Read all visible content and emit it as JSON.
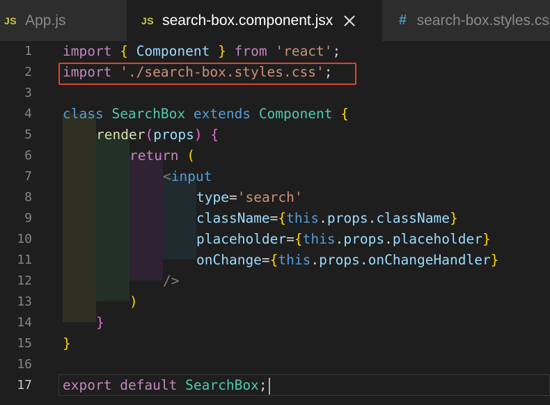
{
  "tabs": [
    {
      "icon": "JS",
      "label": "App.js",
      "active": false
    },
    {
      "icon": "JS",
      "label": "search-box.component.jsx",
      "active": true
    },
    {
      "icon": "#",
      "label": "search-box.styles.css",
      "active": false
    }
  ],
  "line_numbers": [
    "1",
    "2",
    "3",
    "4",
    "5",
    "6",
    "7",
    "8",
    "9",
    "10",
    "11",
    "12",
    "13",
    "14",
    "15",
    "16",
    "17"
  ],
  "active_line": "17",
  "code": {
    "l1": {
      "t1": "import",
      "t2": " ",
      "t3": "{",
      "t4": " ",
      "t5": "Component",
      "t6": " ",
      "t7": "}",
      "t8": " ",
      "t9": "from",
      "t10": " ",
      "t11": "'react'",
      "t12": ";"
    },
    "l2": {
      "t1": "import",
      "t2": " ",
      "t3": "'./search-box.styles.css'",
      "t4": ";"
    },
    "l4": {
      "t1": "class",
      "t2": " ",
      "t3": "SearchBox",
      "t4": " ",
      "t5": "extends",
      "t6": " ",
      "t7": "Component",
      "t8": " ",
      "t9": "{"
    },
    "l5": {
      "t1": "render",
      "t2": "(",
      "t3": "props",
      "t4": ")",
      "t5": " ",
      "t6": "{"
    },
    "l6": {
      "t1": "return",
      "t2": " ",
      "t3": "("
    },
    "l7": {
      "t1": "<",
      "t2": "input"
    },
    "l8": {
      "t1": "type",
      "t2": "=",
      "t3": "'search'"
    },
    "l9": {
      "t1": "className",
      "t2": "=",
      "t3": "{",
      "t4": "this",
      "t5": ".",
      "t6": "props",
      "t7": ".",
      "t8": "className",
      "t9": "}"
    },
    "l10": {
      "t1": "placeholder",
      "t2": "=",
      "t3": "{",
      "t4": "this",
      "t5": ".",
      "t6": "props",
      "t7": ".",
      "t8": "placeholder",
      "t9": "}"
    },
    "l11": {
      "t1": "onChange",
      "t2": "=",
      "t3": "{",
      "t4": "this",
      "t5": ".",
      "t6": "props",
      "t7": ".",
      "t8": "onChangeHandler",
      "t9": "}"
    },
    "l12": {
      "t1": "/>"
    },
    "l13": {
      "t1": ")"
    },
    "l14": {
      "t1": "}"
    },
    "l15": {
      "t1": "}"
    },
    "l17": {
      "t1": "export",
      "t2": " ",
      "t3": "default",
      "t4": " ",
      "t5": "SearchBox",
      "t6": ";"
    }
  },
  "colors": {
    "editor_bg": "#1e1e1e",
    "highlight_border": "#d9472b",
    "indent_1": "#2e2f20",
    "indent_2": "#223028",
    "indent_3": "#2e2233",
    "indent_4": "#1f2b2e"
  }
}
